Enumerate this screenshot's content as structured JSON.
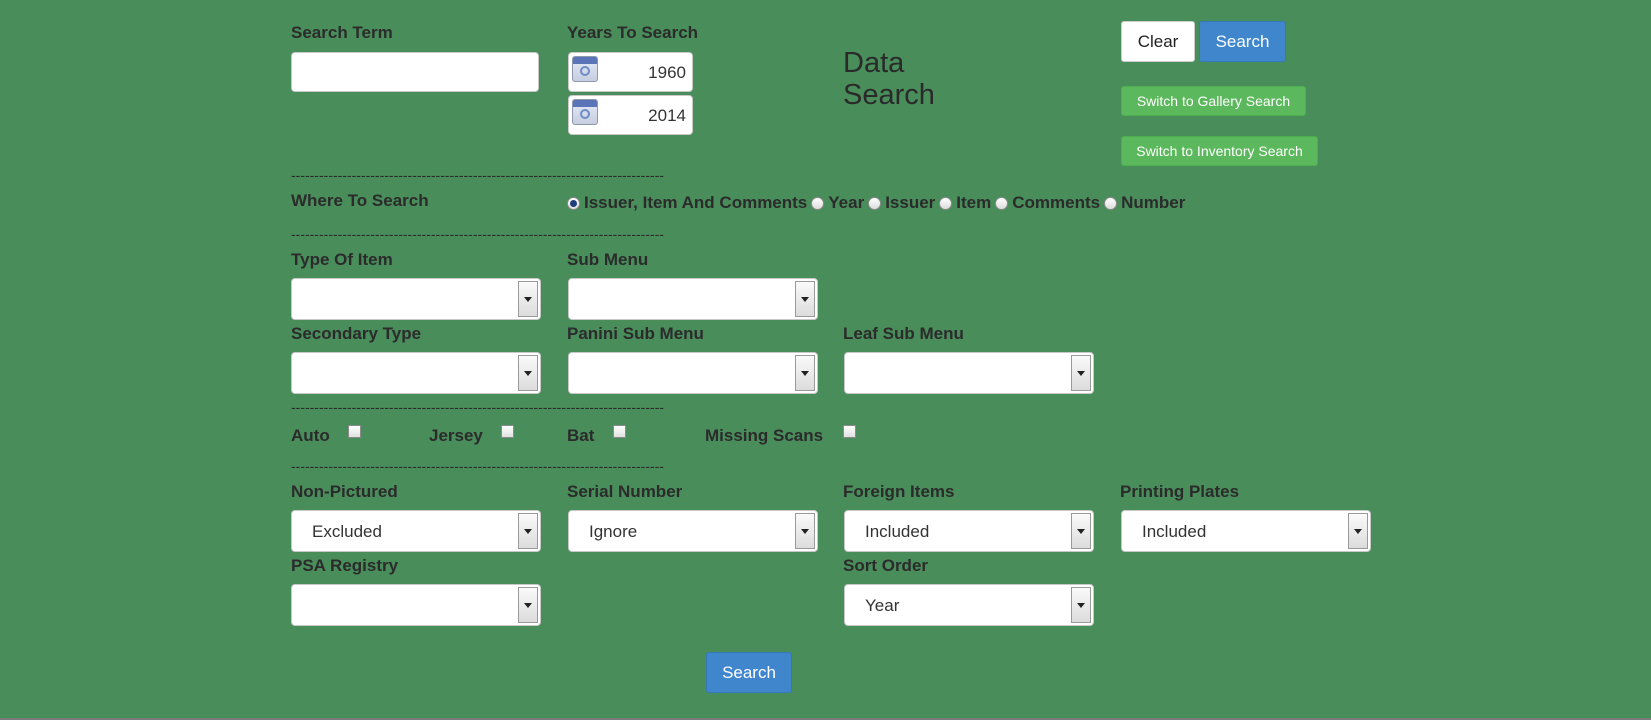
{
  "search_term": {
    "label": "Search Term",
    "value": ""
  },
  "years": {
    "label": "Years To Search",
    "from": "1960",
    "to": "2014"
  },
  "title": {
    "line1": "Data",
    "line2": "Search"
  },
  "buttons": {
    "clear": "Clear",
    "search_top": "Search",
    "gallery": "Switch to Gallery Search",
    "inventory": "Switch to Inventory Search",
    "search_bottom": "Search"
  },
  "separator": "--------------------------------------------------------------------------------",
  "where": {
    "label": "Where To Search",
    "options": [
      "Issuer, Item And Comments",
      "Year",
      "Issuer",
      "Item",
      "Comments",
      "Number"
    ],
    "selected": "Issuer, Item And Comments"
  },
  "filters": {
    "type_of_item": {
      "label": "Type Of Item",
      "value": ""
    },
    "sub_menu": {
      "label": "Sub Menu",
      "value": ""
    },
    "secondary_type": {
      "label": "Secondary Type",
      "value": ""
    },
    "panini_sub_menu": {
      "label": "Panini Sub Menu",
      "value": ""
    },
    "leaf_sub_menu": {
      "label": "Leaf Sub Menu",
      "value": ""
    }
  },
  "checkboxes": {
    "auto": {
      "label": "Auto",
      "checked": false
    },
    "jersey": {
      "label": "Jersey",
      "checked": false
    },
    "bat": {
      "label": "Bat",
      "checked": false
    },
    "missing_scans": {
      "label": "Missing Scans",
      "checked": false
    }
  },
  "options": {
    "non_pictured": {
      "label": "Non-Pictured",
      "value": "Excluded"
    },
    "serial_number": {
      "label": "Serial Number",
      "value": "Ignore"
    },
    "foreign_items": {
      "label": "Foreign Items",
      "value": "Included"
    },
    "printing_plates": {
      "label": "Printing Plates",
      "value": "Included"
    },
    "psa_registry": {
      "label": "PSA Registry",
      "value": ""
    },
    "sort_order": {
      "label": "Sort Order",
      "value": "Year"
    }
  },
  "colors": {
    "background": "#498d5b",
    "primary": "#3f86cd",
    "success": "#5cb85c"
  }
}
